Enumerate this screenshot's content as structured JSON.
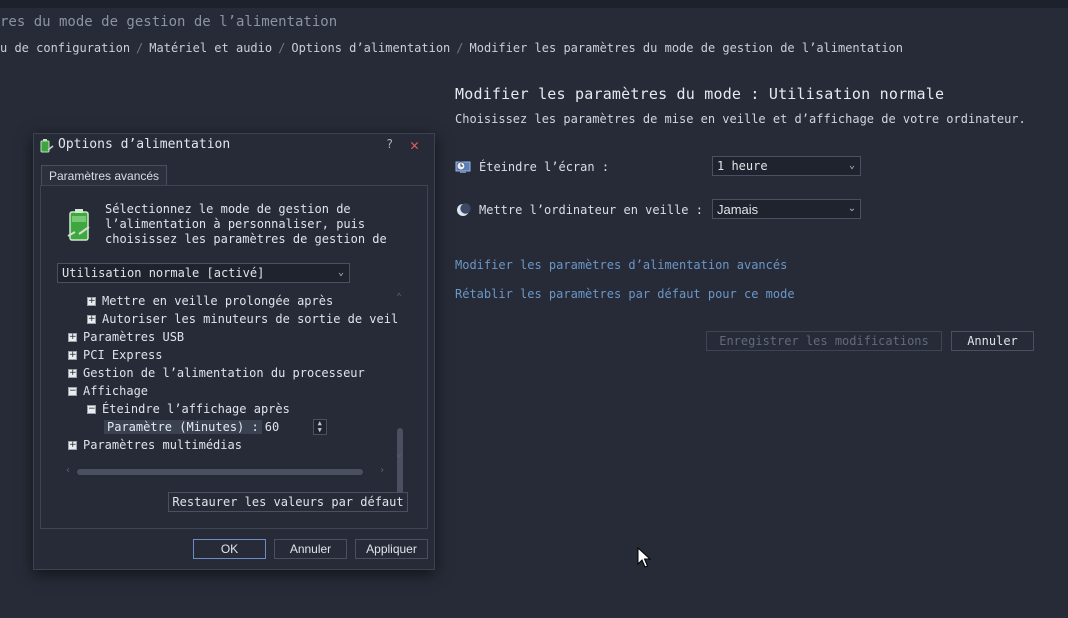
{
  "window": {
    "title": "res du mode de gestion de l’alimentation"
  },
  "breadcrumb": [
    "u de configuration",
    "Matériel et audio",
    "Options d’alimentation",
    "Modifier les paramètres du mode de gestion de l’alimentation"
  ],
  "main": {
    "title": "Modifier les paramètres du mode : Utilisation normale",
    "subtitle": "Choisissez les paramètres de mise en veille et d’affichage de votre ordinateur.",
    "screen_off": {
      "label": "Éteindre l’écran :",
      "value": "1 heure",
      "icon": "monitor-clock-icon"
    },
    "sleep": {
      "label": "Mettre l’ordinateur en veille :",
      "value": "Jamais",
      "icon": "moon-icon"
    },
    "link_advanced": "Modifier les paramètres d’alimentation avancés",
    "link_restore": "Rétablir les paramètres par défaut pour ce mode",
    "save_label": "Enregistrer les modifications",
    "cancel_label": "Annuler"
  },
  "dialog": {
    "title": "Options d’alimentation",
    "help": "?",
    "close": "✕",
    "tab": "Paramètres avancés",
    "intro_lines": [
      "Sélectionnez le mode de gestion de",
      "l’alimentation à personnaliser, puis",
      "choisissez les paramètres de gestion de"
    ],
    "plan_value": "Utilisation normale [activé]",
    "tree": [
      {
        "label": "Mettre en veille prolongée après",
        "sign": "+"
      },
      {
        "label": "Autoriser les minuteurs de sortie de veil",
        "sign": "+"
      },
      {
        "label": "Paramètres USB",
        "sign": "+"
      },
      {
        "label": "PCI Express",
        "sign": "+"
      },
      {
        "label": "Gestion de l’alimentation du processeur",
        "sign": "+"
      },
      {
        "label": "Affichage",
        "sign": "−"
      },
      {
        "label": "Éteindre l’affichage après",
        "sign": "−"
      },
      {
        "label": "Paramètres multimédias",
        "sign": "+"
      }
    ],
    "param_label": "Paramètre (Minutes) :",
    "param_value": "60",
    "restore_label": "Restaurer les valeurs par défaut",
    "ok_label": "OK",
    "cancel_label": "Annuler",
    "apply_label": "Appliquer"
  },
  "colors": {
    "background": "#262b37",
    "link": "#6c96c6",
    "close": "#e05a5a"
  }
}
